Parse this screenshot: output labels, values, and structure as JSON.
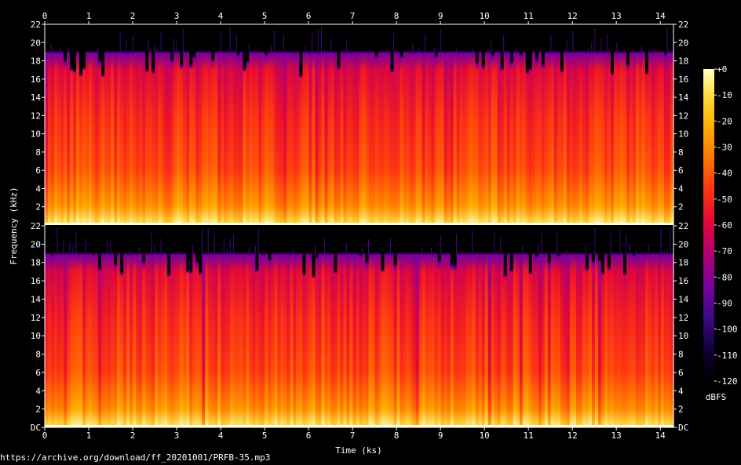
{
  "chart_data": {
    "type": "heatmap",
    "xlabel": "Time (ks)",
    "ylabel": "Frequency (kHz)",
    "colorbar_label": "dBFS",
    "x_ticks": [
      "0",
      "1",
      "2",
      "3",
      "4",
      "5",
      "6",
      "7",
      "8",
      "9",
      "10",
      "11",
      "12",
      "13",
      "14"
    ],
    "xlim": [
      0,
      14.3
    ],
    "y_ticks": [
      "DC",
      "2",
      "4",
      "6",
      "8",
      "10",
      "12",
      "14",
      "16",
      "18",
      "20",
      "22"
    ],
    "ylim": [
      0,
      22
    ],
    "colorbar_ticks": [
      "+0",
      "-10",
      "-20",
      "-30",
      "-40",
      "-50",
      "-60",
      "-70",
      "-80",
      "-90",
      "-100",
      "-110",
      "-120"
    ],
    "colorbar_range": [
      -120,
      0
    ],
    "colormap": [
      "#000000",
      "#10003a",
      "#3a0a82",
      "#7a00a0",
      "#b8006a",
      "#e80a30",
      "#ff3a10",
      "#ff7a00",
      "#ffb000",
      "#ffe040",
      "#ffffc8"
    ],
    "channels": [
      {
        "name": "",
        "cutoff_khz": 18.8,
        "band_levels_dbfs": [
          [
            0,
            -8
          ],
          [
            2,
            -30
          ],
          [
            6,
            -45
          ],
          [
            12,
            -52
          ],
          [
            17,
            -62
          ],
          [
            18.8,
            -85
          ],
          [
            22,
            -120
          ]
        ]
      },
      {
        "name": "",
        "cutoff_khz": 18.8,
        "band_levels_dbfs": [
          [
            0,
            -8
          ],
          [
            2,
            -30
          ],
          [
            6,
            -45
          ],
          [
            12,
            -52
          ],
          [
            17,
            -62
          ],
          [
            18.8,
            -85
          ],
          [
            22,
            -120
          ]
        ]
      }
    ]
  },
  "source": {
    "url": "https://archive.org/download/ff_20201001/PRFB-35.mp3"
  }
}
